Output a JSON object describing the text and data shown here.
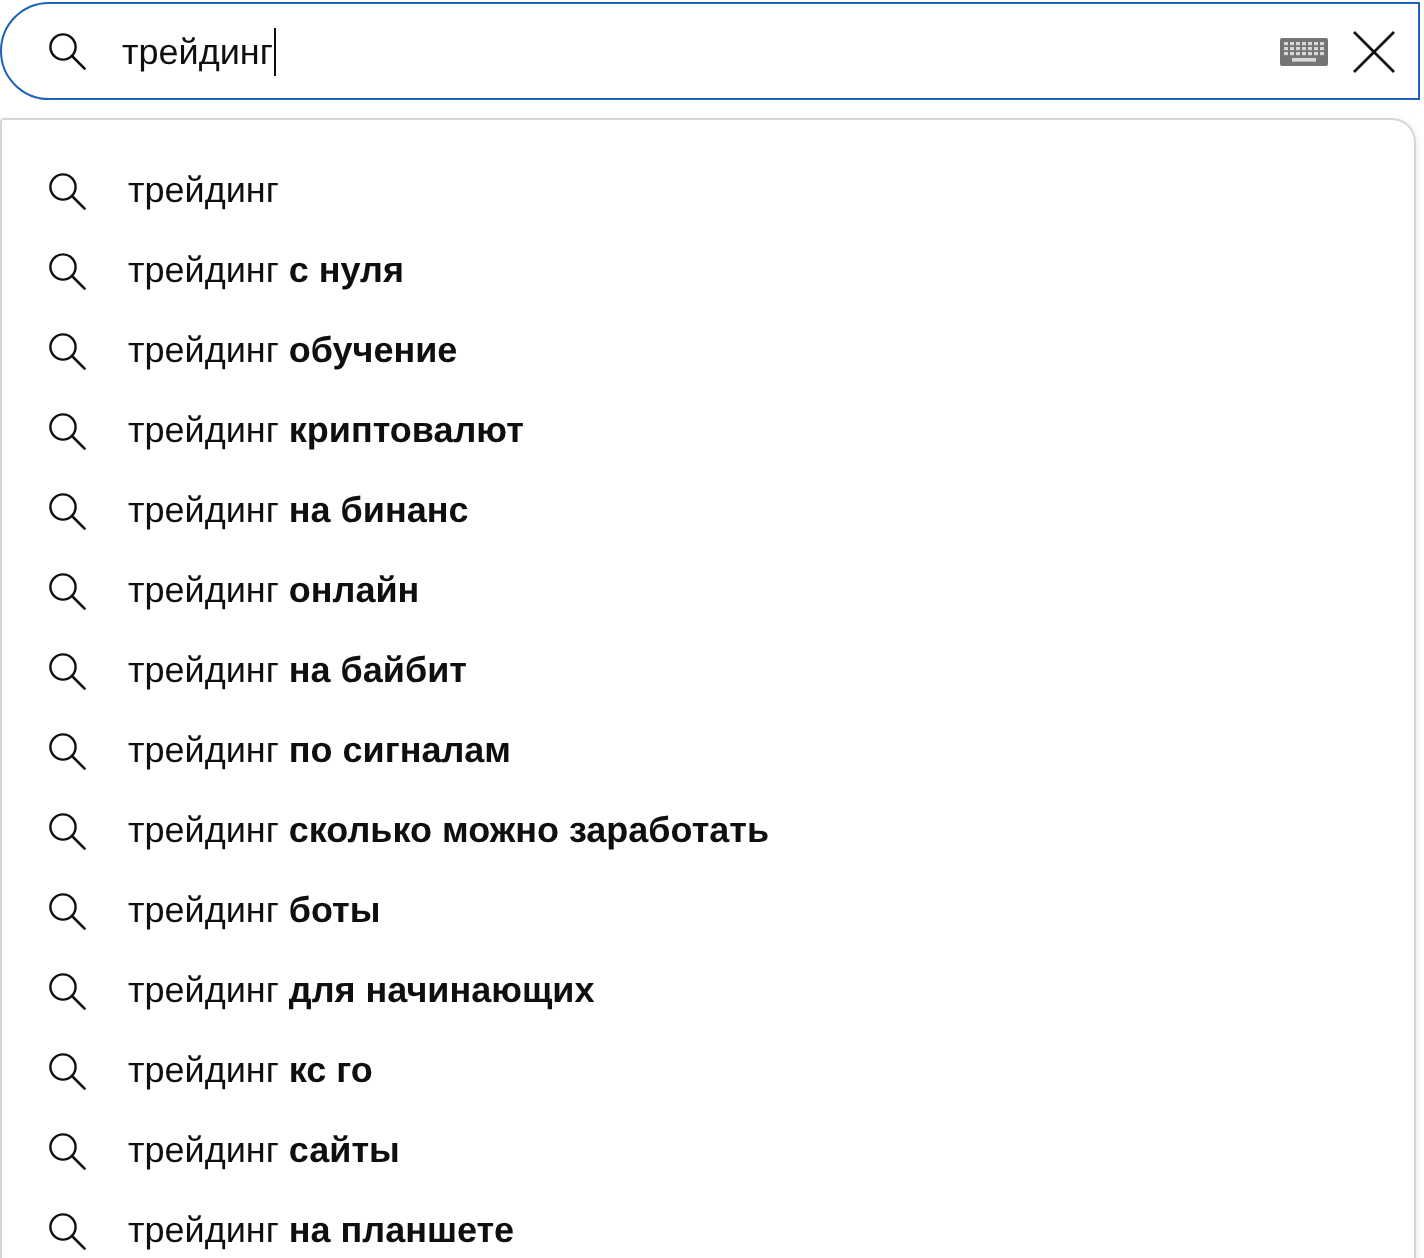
{
  "search": {
    "value": "трейдинг"
  },
  "suggestions": [
    "трейдинг",
    "трейдинг **с нуля**",
    "трейдинг **обучение**",
    "трейдинг **криптовалют**",
    "трейдинг **на бинанс**",
    "трейдинг **онлайн**",
    "трейдинг **на байбит**",
    "трейдинг **по сигналам**",
    "трейдинг **сколько можно заработать**",
    "трейдинг **боты**",
    "трейдинг **для начинающих**",
    "трейдинг **кс го**",
    "трейдинг **сайты**",
    "трейдинг **на планшете**"
  ]
}
